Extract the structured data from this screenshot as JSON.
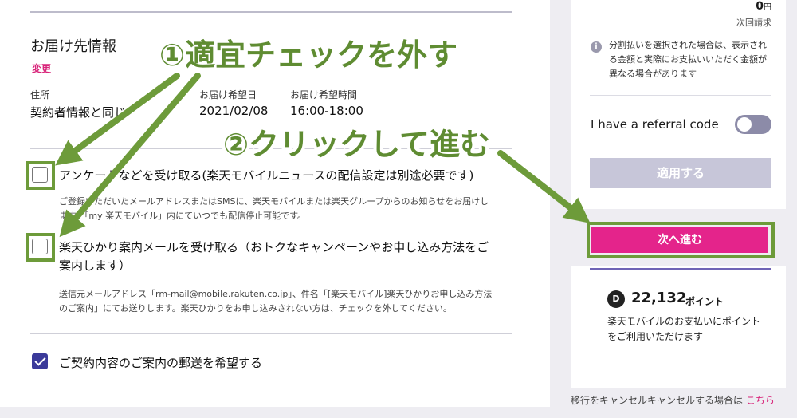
{
  "summary": {
    "amount": "0",
    "amount_unit": "円",
    "next_bill": "次回請求",
    "info_text": "分割払いを選択された場合は、表示される金額と実際にお支払いいただく金額が異なる場合があります",
    "referral_label": "I have a referral code",
    "apply_label": "適用する",
    "next_label": "次へ進む",
    "points_value": "22,132",
    "points_unit": "ポイント",
    "points_text": "楽天モバイルのお支払いにポイントをご利用いただけます",
    "cancel_text": "移行をキャンセルキャンセルする場合は",
    "cancel_link": "こちら"
  },
  "delivery": {
    "title": "お届け先情報",
    "change": "変更",
    "address_label": "住所",
    "address_value": "契約者情報と同じ",
    "date_label": "お届け希望日",
    "date_value": "2021/02/08",
    "time_label": "お届け希望時間",
    "time_value": "16:00-18:00"
  },
  "options": {
    "survey_label": "アンケートなどを受け取る(楽天モバイルニュースの配信設定は別途必要です)",
    "survey_desc_1": "ご登録いただいたメールアドレスまたはSMSに、楽天モバイルまたは楽天グループからのお知らせをお届けし",
    "survey_desc_2": "ます。「my 楽天モバイル」内にていつでも配信停止可能です。",
    "hikari_label_1": "楽天ひかり案内メールを受け取る（おトクなキャンペーンやお申し込み方法をご",
    "hikari_label_2": "案内します）",
    "hikari_desc_1": "送信元メールアドレス「rm-mail@mobile.rakuten.co.jp」、件名「[楽天モバイル]楽天ひかりお申し込み方法",
    "hikari_desc_2": "のご案内」にてお送りします。楽天ひかりをお申し込みされない方は、チェックを外してください。",
    "mail_label": "ご契約内容のご案内の郵送を希望する"
  },
  "annotations": {
    "step1": "①適宜チェックを外す",
    "step2": "②クリックして進む"
  },
  "colors": {
    "accent_pink": "#e4248b",
    "annotation_green": "#6d9b3a",
    "checkbox_checked": "#3b3a9a"
  }
}
